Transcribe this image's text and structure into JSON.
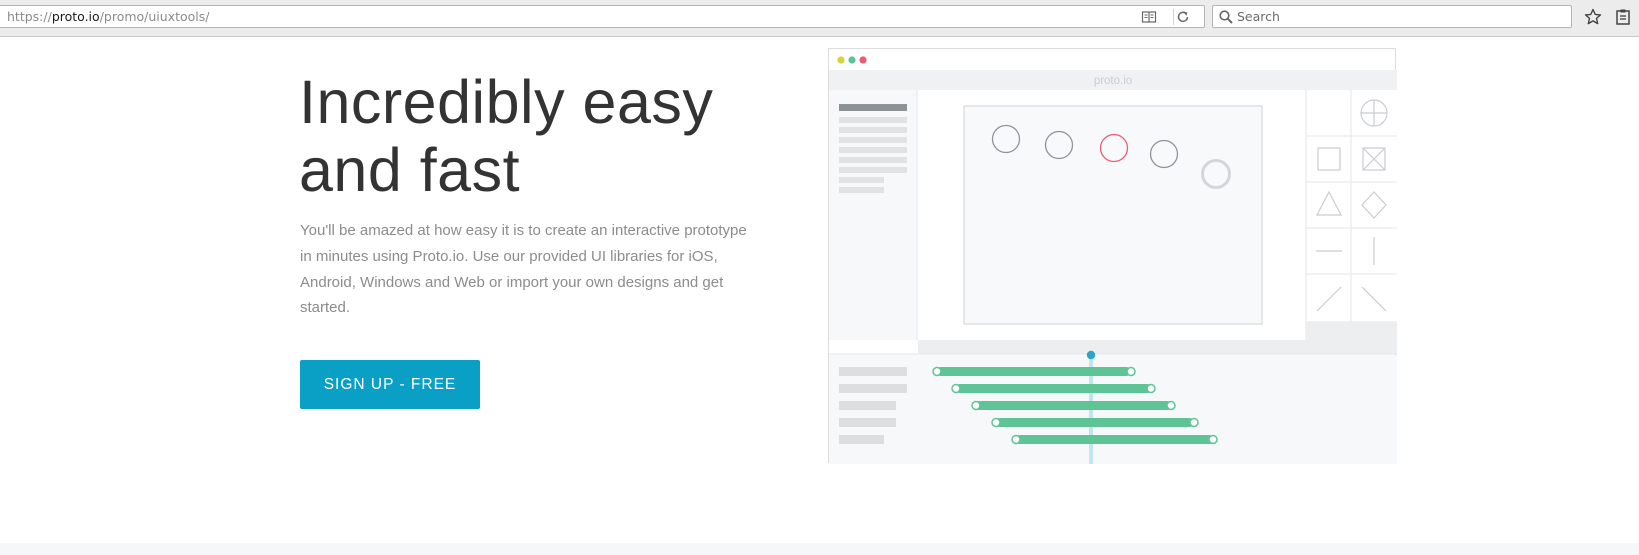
{
  "browser": {
    "url_prefix": "https://",
    "url_host": "proto.io",
    "url_path": "/promo/uiuxtools/",
    "search_placeholder": "Search"
  },
  "hero": {
    "title_line1": "Incredibly easy",
    "title_line2": "and fast",
    "body": "You'll be amazed at how easy it is to create an interactive prototype in minutes using Proto.io. Use our provided UI libraries for iOS, Android, Windows and Web or import your own designs and get started.",
    "cta_label": "SIGN UP - FREE"
  },
  "illustration": {
    "app_logo": "proto.io",
    "window_dots": [
      "#d4d43a",
      "#5fc495",
      "#ef5b74"
    ],
    "accent": "#5fc495",
    "playhead_color": "#2aa6c9",
    "selected_circle_color": "#ef5b74",
    "tools": [
      "plus-circle-icon",
      "square-icon",
      "x-box-icon",
      "triangle-icon",
      "diamond-icon",
      "horizontal-line-icon",
      "vertical-line-icon",
      "diagonal-up-icon",
      "diagonal-down-icon"
    ]
  },
  "colors": {
    "cta": "#0a9fc4",
    "title": "#333333",
    "body": "#8c8c8c"
  }
}
